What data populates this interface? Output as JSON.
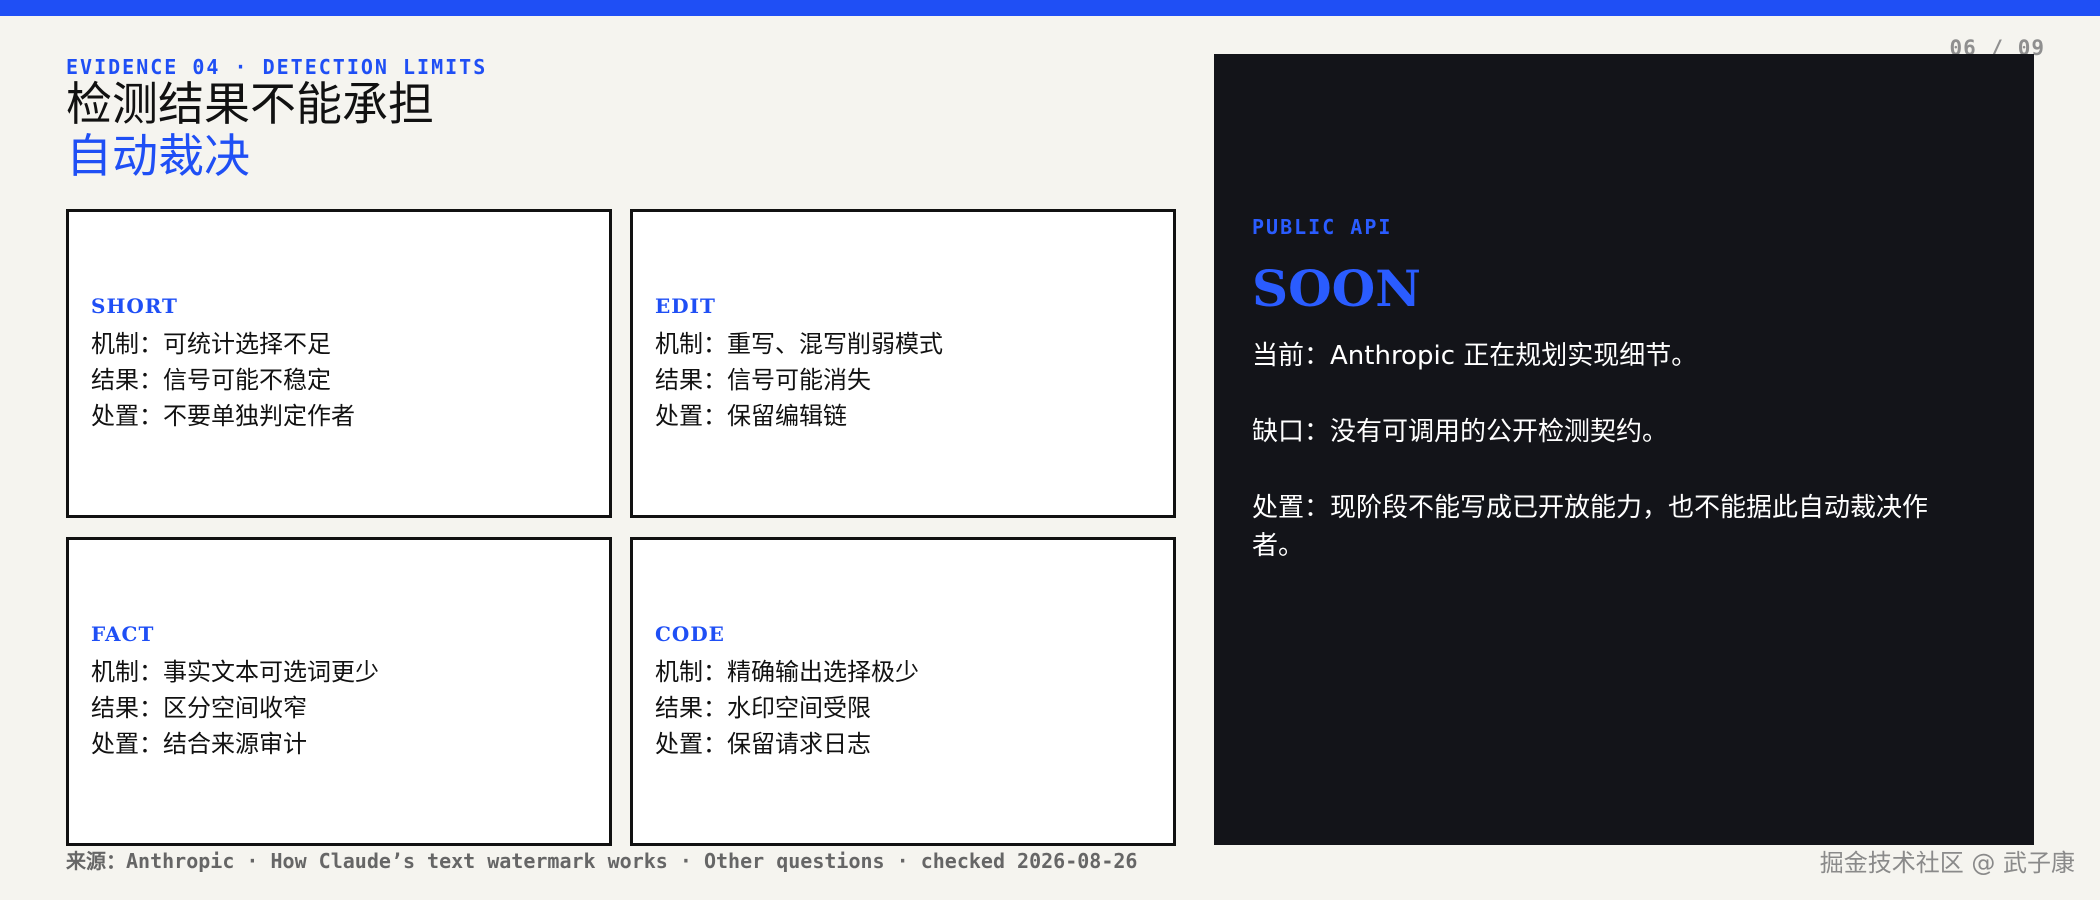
{
  "page": {
    "counter": "06 / 09"
  },
  "header": {
    "eyebrow": "EVIDENCE 04 · DETECTION LIMITS",
    "title_line1": "检测结果不能承担",
    "title_line2": "自动裁决"
  },
  "cards": [
    {
      "label": "SHORT",
      "lines": [
        "机制：可统计选择不足",
        "结果：信号可能不稳定",
        "处置：不要单独判定作者"
      ]
    },
    {
      "label": "EDIT",
      "lines": [
        "机制：重写、混写削弱模式",
        "结果：信号可能消失",
        "处置：保留编辑链"
      ]
    },
    {
      "label": "FACT",
      "lines": [
        "机制：事实文本可选词更少",
        "结果：区分空间收窄",
        "处置：结合来源审计"
      ]
    },
    {
      "label": "CODE",
      "lines": [
        "机制：精确输出选择极少",
        "结果：水印空间受限",
        "处置：保留请求日志"
      ]
    }
  ],
  "panel": {
    "eyebrow": "PUBLIC API",
    "status": "SOON",
    "lines": [
      "当前：Anthropic 正在规划实现细节。",
      "缺口：没有可调用的公开检测契约。",
      "处置：现阶段不能写成已开放能力，也不能据此自动裁决作者。"
    ]
  },
  "footer": {
    "source": "来源：Anthropic · How Claude’s text watermark works · Other questions · checked 2026-08-26",
    "watermark": "掘金技术社区 @ 武子康"
  },
  "colors": {
    "accent": "#1f4ff5",
    "panel_bg": "#131419",
    "page_bg": "#f5f4ef"
  }
}
